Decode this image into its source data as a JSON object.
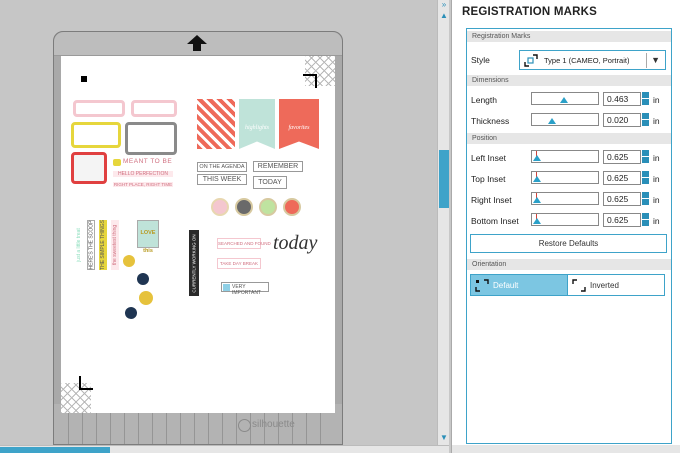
{
  "canvas": {
    "brand": "silhouette",
    "stickers": {
      "meant_to_be": "MEANT TO BE",
      "hello_perfection": "HELLO PERFECTION",
      "right_place": "RIGHT PLACE, RIGHT TIME",
      "on_the_agenda": "ON THE AGENDA",
      "remember": "REMEMBER",
      "this_week": "THIS WEEK",
      "today": "TODAY",
      "highlights": "highlights",
      "favorites": "favorites",
      "love_this": "LOVE this",
      "very_important": "VERY IMPORTANT",
      "today_script": "today",
      "currently_working_on": "CURRENTLY WORKING ON",
      "strip_1": "just a little treat",
      "strip_2": "HERE'S THE SCOOP",
      "strip_3": "THE SIMPLE THINGS",
      "strip_4": "the sweetest thing",
      "badge_1": "SEARCHED AND FOUND",
      "badge_2": "TAKE DAY BREAK"
    }
  },
  "panel": {
    "title": "REGISTRATION MARKS",
    "registration_marks_header": "Registration Marks",
    "style_label": "Style",
    "style_value": "Type 1 (CAMEO, Portrait)",
    "dimensions_header": "Dimensions",
    "length_label": "Length",
    "length_value": "0.463",
    "length_unit": "in",
    "thickness_label": "Thickness",
    "thickness_value": "0.020",
    "thickness_unit": "in",
    "position_header": "Position",
    "left_inset_label": "Left Inset",
    "left_inset_value": "0.625",
    "top_inset_label": "Top Inset",
    "top_inset_value": "0.625",
    "right_inset_label": "Right Inset",
    "right_inset_value": "0.625",
    "bottom_inset_label": "Bottom Inset",
    "bottom_inset_value": "0.625",
    "inset_unit": "in",
    "restore_defaults": "Restore Defaults",
    "orientation_header": "Orientation",
    "orientation_default": "Default",
    "orientation_inverted": "Inverted",
    "selected_orientation": "Default"
  },
  "colors": {
    "accent": "#3ea3c9",
    "selected": "#7cc6e2",
    "slider_knob": "#2aa0c8",
    "slider_needle": "#d0453b"
  }
}
